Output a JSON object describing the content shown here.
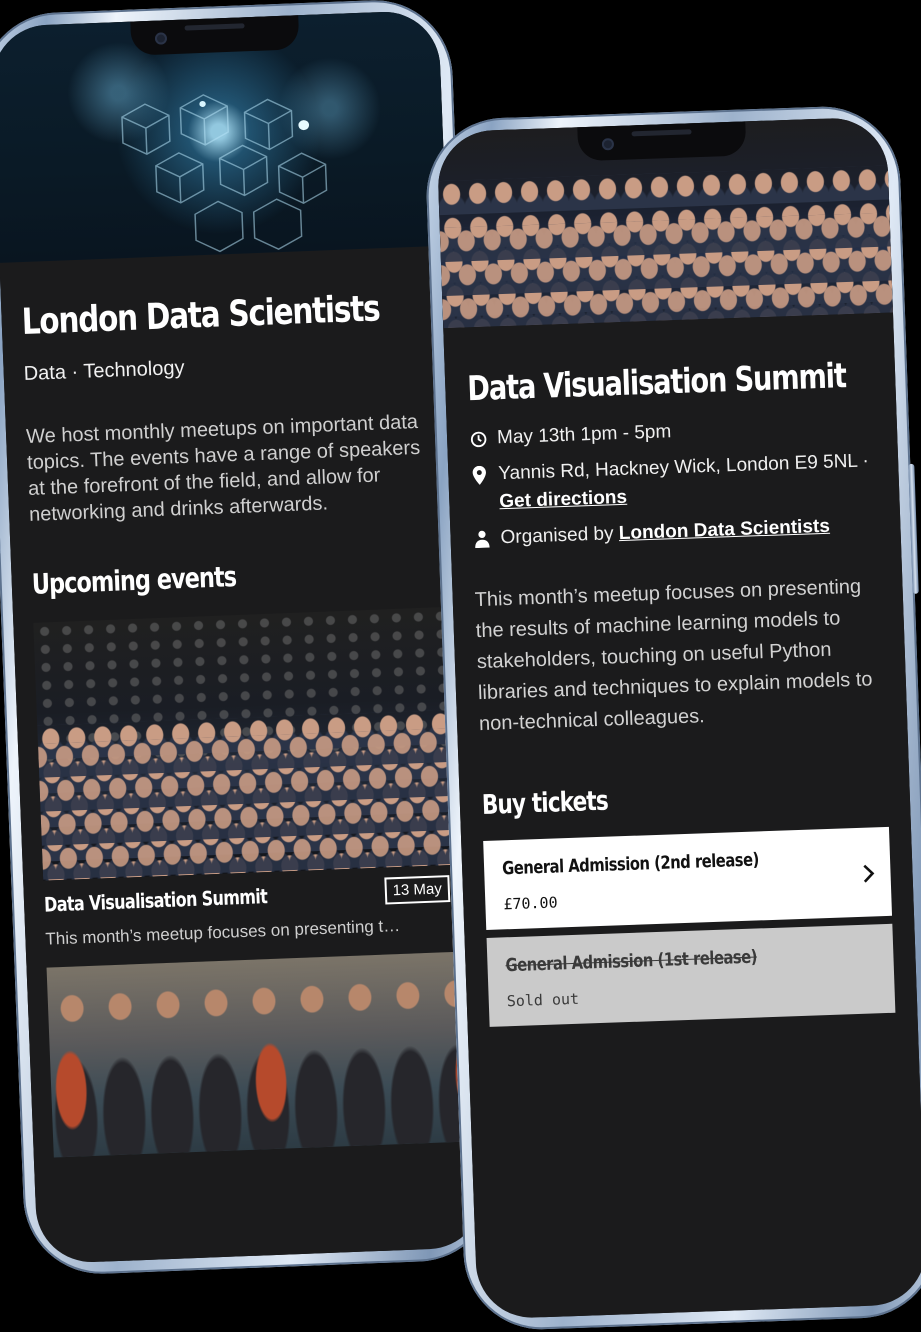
{
  "group_page": {
    "title": "London Data Scientists",
    "categories": "Data · Technology",
    "about": "We host monthly meetups on important data topics. The events have a range of speakers at the forefront of the field, and allow for networking and drinks afterwards.",
    "upcoming_heading": "Upcoming events",
    "events": [
      {
        "title": "Data Visualisation Summit",
        "date": "13 May",
        "description": "This month’s meetup focuses on presenting the res..."
      }
    ]
  },
  "event_page": {
    "title": "Data Visualisation Summit",
    "datetime": "May 13th 1pm - 5pm",
    "location": "Yannis Rd, Hackney Wick, London E9 5NL ·",
    "directions_label": "Get directions",
    "organiser_prefix": "Organised by ",
    "organiser": "London Data Scientists",
    "description": "This month’s meetup focuses on presenting the results of machine learning models to stakeholders, touching on useful Python libraries and techniques to explain models to non-technical colleagues.",
    "tickets_heading": "Buy tickets",
    "tickets": [
      {
        "name": "General Admission (2nd release)",
        "price": "£70.00"
      },
      {
        "name": "General Admission (1st release)",
        "price": "Sold out"
      }
    ]
  },
  "icons": [
    "clock-icon",
    "location-pin-icon",
    "person-icon",
    "chevron-right-icon"
  ],
  "colors": {
    "screen_bg": "#1b1b1c",
    "ticket_bg": "#ffffff",
    "sold_out_bg": "#cacaca",
    "text": "#ffffff"
  }
}
